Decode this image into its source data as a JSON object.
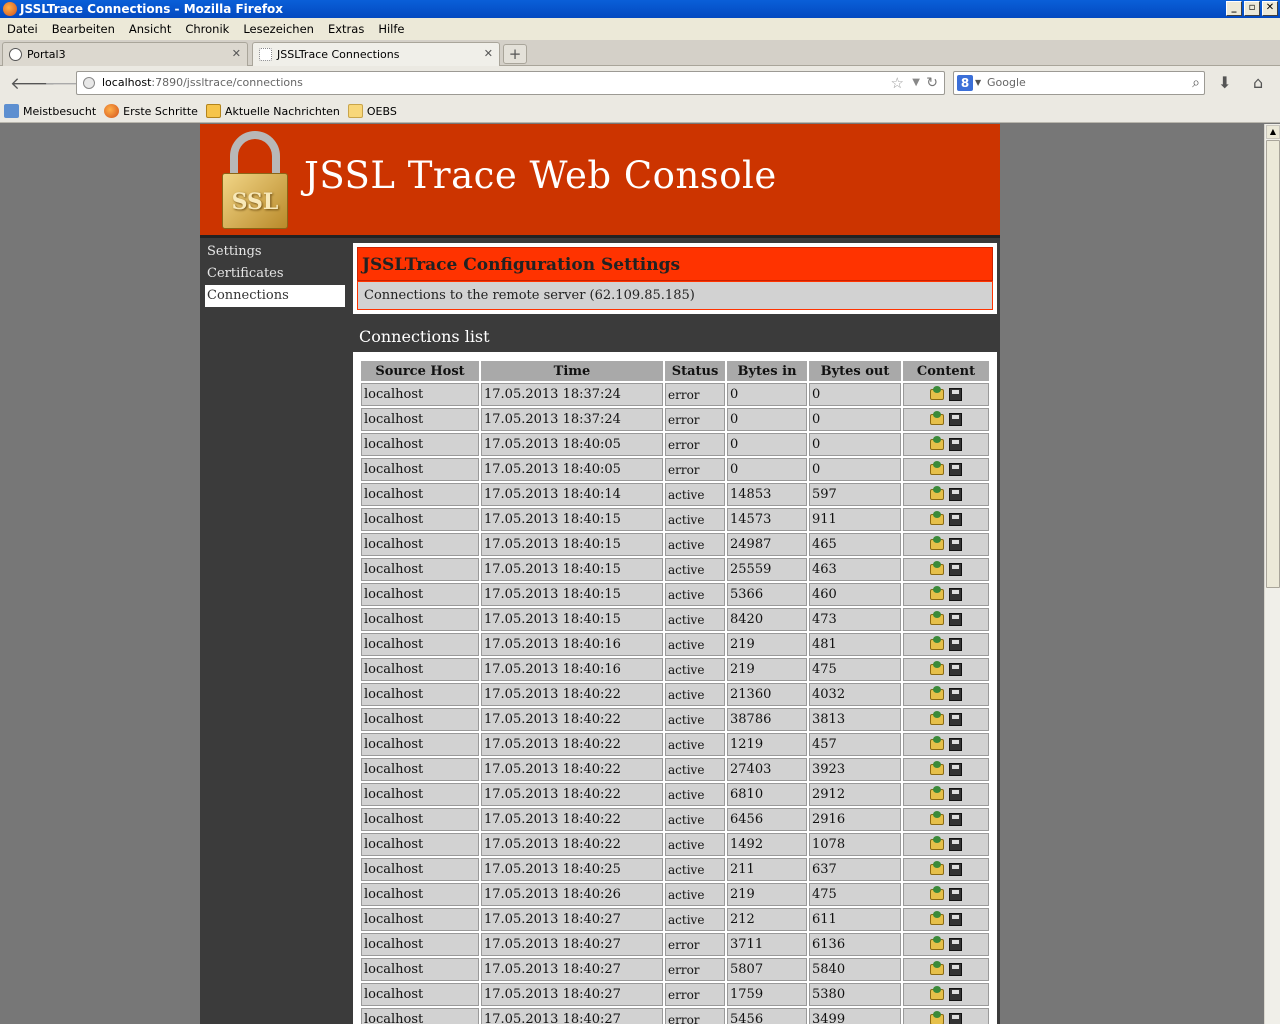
{
  "window": {
    "title": "JSSLTrace Connections - Mozilla Firefox"
  },
  "menubar": [
    "Datei",
    "Bearbeiten",
    "Ansicht",
    "Chronik",
    "Lesezeichen",
    "Extras",
    "Hilfe"
  ],
  "tabs": [
    {
      "label": "Portal3"
    },
    {
      "label": "JSSLTrace Connections"
    }
  ],
  "address": {
    "host": "localhost",
    "path": ":7890/jssltrace/connections"
  },
  "search": {
    "placeholder": "Google"
  },
  "bookmarks": [
    "Meistbesucht",
    "Erste Schritte",
    "Aktuelle Nachrichten",
    "OEBS"
  ],
  "banner": {
    "logo_text": "SSL",
    "title": "JSSL Trace Web Console"
  },
  "sidebar": {
    "items": [
      {
        "label": "Settings"
      },
      {
        "label": "Certificates"
      },
      {
        "label": "Connections"
      }
    ]
  },
  "config": {
    "title": "JSSLTrace Configuration Settings",
    "subtitle": "Connections to the remote server (62.109.85.185)"
  },
  "connections": {
    "title": "Connections list",
    "columns": [
      "Source Host",
      "Time",
      "Status",
      "Bytes in",
      "Bytes out",
      "Content"
    ],
    "rows": [
      [
        "localhost",
        "17.05.2013 18:37:24",
        "error",
        "0",
        "0"
      ],
      [
        "localhost",
        "17.05.2013 18:37:24",
        "error",
        "0",
        "0"
      ],
      [
        "localhost",
        "17.05.2013 18:40:05",
        "error",
        "0",
        "0"
      ],
      [
        "localhost",
        "17.05.2013 18:40:05",
        "error",
        "0",
        "0"
      ],
      [
        "localhost",
        "17.05.2013 18:40:14",
        "active",
        "14853",
        "597"
      ],
      [
        "localhost",
        "17.05.2013 18:40:15",
        "active",
        "14573",
        "911"
      ],
      [
        "localhost",
        "17.05.2013 18:40:15",
        "active",
        "24987",
        "465"
      ],
      [
        "localhost",
        "17.05.2013 18:40:15",
        "active",
        "25559",
        "463"
      ],
      [
        "localhost",
        "17.05.2013 18:40:15",
        "active",
        "5366",
        "460"
      ],
      [
        "localhost",
        "17.05.2013 18:40:15",
        "active",
        "8420",
        "473"
      ],
      [
        "localhost",
        "17.05.2013 18:40:16",
        "active",
        "219",
        "481"
      ],
      [
        "localhost",
        "17.05.2013 18:40:16",
        "active",
        "219",
        "475"
      ],
      [
        "localhost",
        "17.05.2013 18:40:22",
        "active",
        "21360",
        "4032"
      ],
      [
        "localhost",
        "17.05.2013 18:40:22",
        "active",
        "38786",
        "3813"
      ],
      [
        "localhost",
        "17.05.2013 18:40:22",
        "active",
        "1219",
        "457"
      ],
      [
        "localhost",
        "17.05.2013 18:40:22",
        "active",
        "27403",
        "3923"
      ],
      [
        "localhost",
        "17.05.2013 18:40:22",
        "active",
        "6810",
        "2912"
      ],
      [
        "localhost",
        "17.05.2013 18:40:22",
        "active",
        "6456",
        "2916"
      ],
      [
        "localhost",
        "17.05.2013 18:40:22",
        "active",
        "1492",
        "1078"
      ],
      [
        "localhost",
        "17.05.2013 18:40:25",
        "active",
        "211",
        "637"
      ],
      [
        "localhost",
        "17.05.2013 18:40:26",
        "active",
        "219",
        "475"
      ],
      [
        "localhost",
        "17.05.2013 18:40:27",
        "active",
        "212",
        "611"
      ],
      [
        "localhost",
        "17.05.2013 18:40:27",
        "error",
        "3711",
        "6136"
      ],
      [
        "localhost",
        "17.05.2013 18:40:27",
        "error",
        "5807",
        "5840"
      ],
      [
        "localhost",
        "17.05.2013 18:40:27",
        "error",
        "1759",
        "5380"
      ],
      [
        "localhost",
        "17.05.2013 18:40:27",
        "error",
        "5456",
        "3499"
      ]
    ]
  },
  "colors": {
    "banner": "#cc3400",
    "config_title": "#ff3300",
    "sidebar": "#3b3b3b"
  }
}
